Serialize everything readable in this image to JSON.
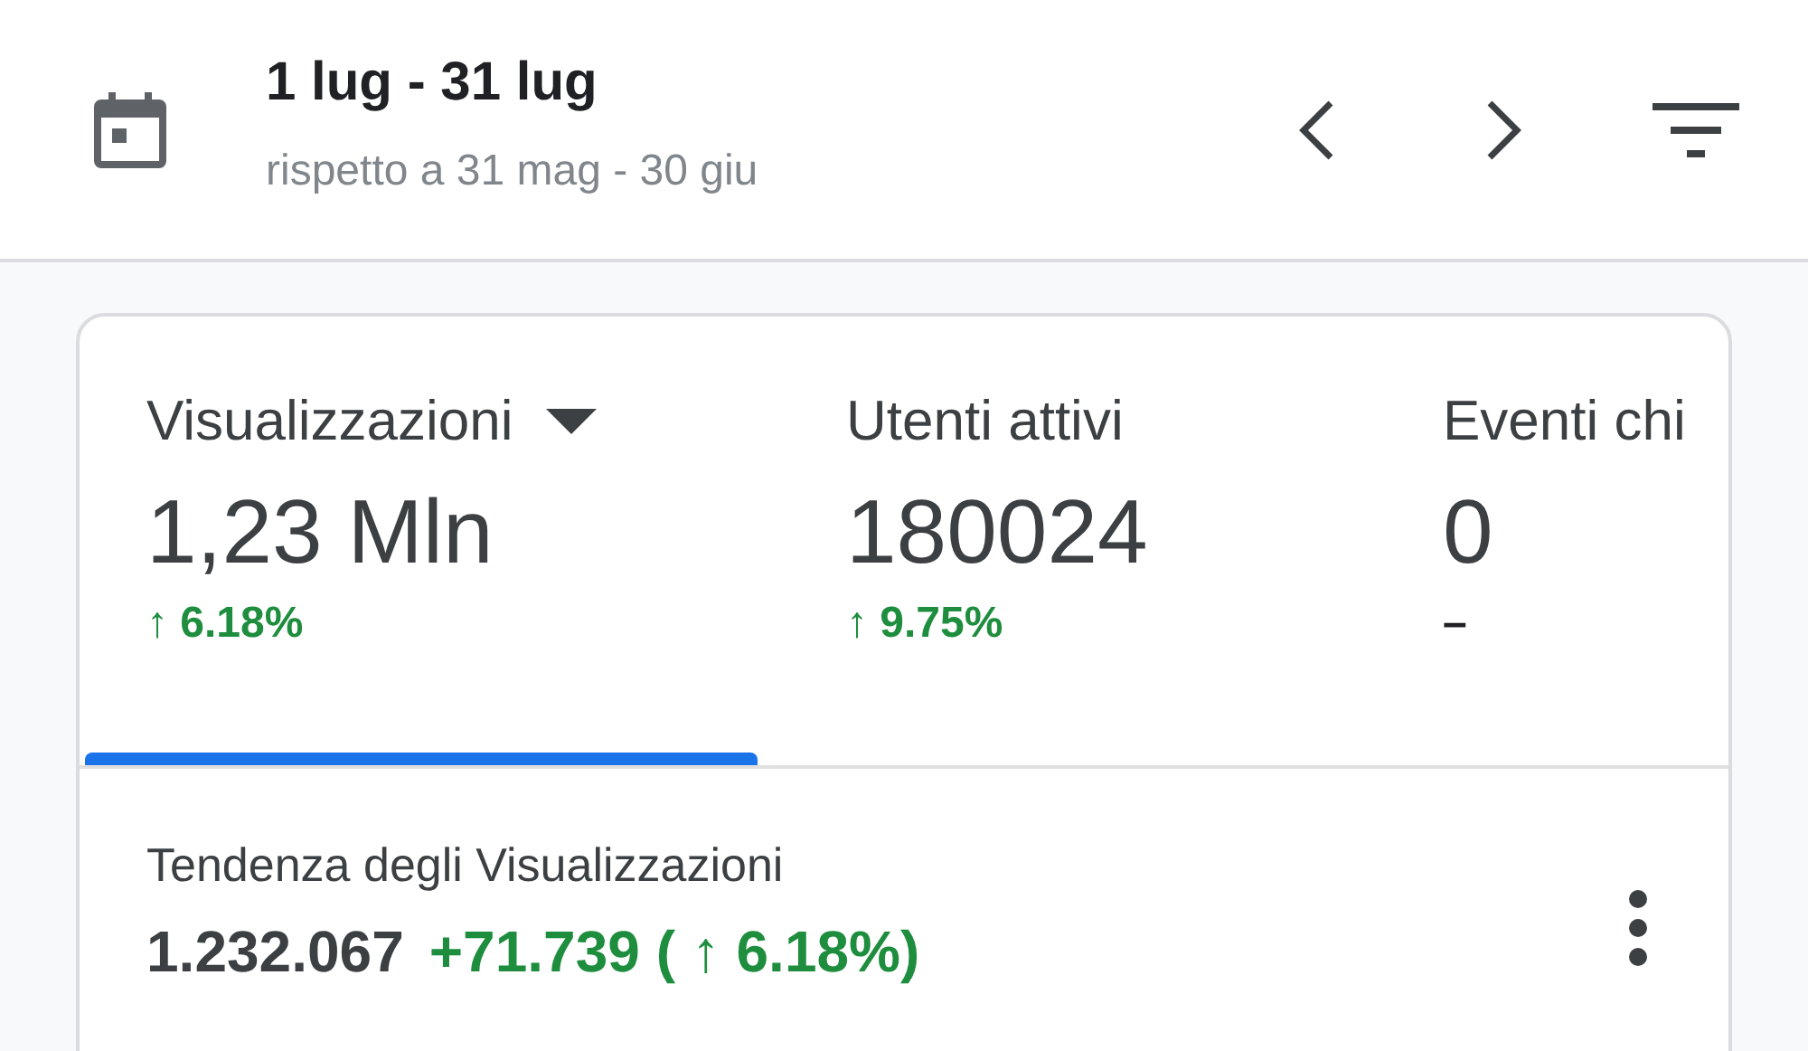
{
  "header": {
    "title": "1 lug - 31 lug",
    "subtitle": "rispetto a 31 mag - 30 giu"
  },
  "metrics": [
    {
      "label": "Visualizzazioni",
      "value": "1,23 Mln",
      "delta": "↑ 6.18%",
      "selected": true,
      "dropdown": true
    },
    {
      "label": "Utenti attivi",
      "value": "180024",
      "delta": "↑ 9.75%",
      "selected": false,
      "dropdown": false
    },
    {
      "label": "Eventi chi",
      "value": "0",
      "delta": "–",
      "selected": false,
      "dropdown": false
    }
  ],
  "trend": {
    "title": "Tendenza degli Visualizzazioni",
    "total": "1.232.067",
    "change": "+71.739 ( ↑ 6.18%)"
  }
}
